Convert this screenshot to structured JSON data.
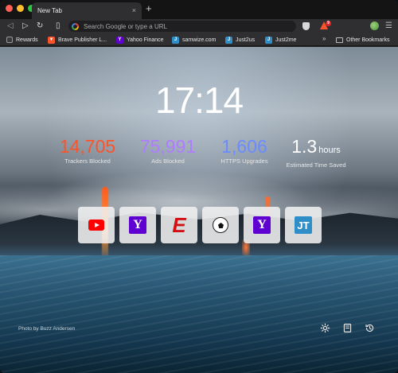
{
  "tab": {
    "title": "New Tab",
    "close": "×",
    "new": "+"
  },
  "toolbar": {
    "back": "◁",
    "forward": "▷",
    "reload": "↻",
    "bookmark": "▯",
    "url_placeholder": "Search Google or type a URL",
    "menu": "☰",
    "rewards_badge": "9"
  },
  "bookmarks": {
    "items": [
      {
        "label": "Rewards",
        "icon": "rewards-icon"
      },
      {
        "label": "Brave Publisher L...",
        "icon": "brave-icon"
      },
      {
        "label": "Yahoo Finance",
        "icon": "yahoo-icon"
      },
      {
        "label": "samwize.com",
        "icon": "samwize-icon"
      },
      {
        "label": "Just2us",
        "icon": "just2us-icon"
      },
      {
        "label": "Just2me",
        "icon": "just2me-icon"
      }
    ],
    "more": "»",
    "other": "Other Bookmarks"
  },
  "main": {
    "clock": "17:14",
    "stats": [
      {
        "value": "14,705",
        "label": "Trackers Blocked",
        "color": "#fb542b"
      },
      {
        "value": "75,991",
        "label": "Ads Blocked",
        "color": "#b07cff"
      },
      {
        "value": "1,606",
        "label": "HTTPS Upgrades",
        "color": "#6b8bff"
      },
      {
        "value": "1.3",
        "unit": "hours",
        "label": "Estimated Time Saved",
        "color": "#ffffff"
      }
    ],
    "tiles": [
      "youtube-icon",
      "yahoo-icon",
      "espn-icon",
      "soccer-ball-icon",
      "yahoo-icon",
      "just2us-icon"
    ],
    "photo_credit": "Photo by Buzz Andersen"
  },
  "colors": {
    "brave_orange": "#fb542b",
    "yahoo_purple": "#5f01d1",
    "espn_red": "#d40f14"
  }
}
